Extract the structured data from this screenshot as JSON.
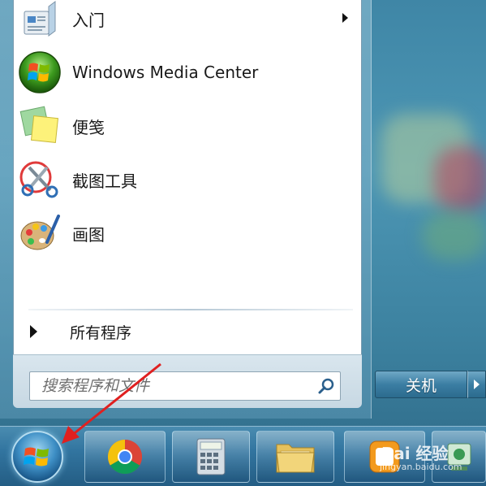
{
  "start_menu": {
    "items": [
      {
        "label": "入门",
        "icon": "getting-started-icon",
        "has_submenu": true
      },
      {
        "label": "Windows Media Center",
        "icon": "windows-media-center-icon",
        "has_submenu": false
      },
      {
        "label": "便笺",
        "icon": "sticky-notes-icon",
        "has_submenu": false
      },
      {
        "label": "截图工具",
        "icon": "snipping-tool-icon",
        "has_submenu": false
      },
      {
        "label": "画图",
        "icon": "paint-icon",
        "has_submenu": false
      }
    ],
    "all_programs_label": "所有程序",
    "search_placeholder": "搜索程序和文件",
    "shutdown_label": "关机"
  },
  "taskbar": {
    "items": [
      {
        "icon": "windows-start-orb-icon"
      },
      {
        "icon": "chrome-icon"
      },
      {
        "icon": "calculator-icon"
      },
      {
        "icon": "file-explorer-icon"
      },
      {
        "icon": "baidu-app-icon"
      },
      {
        "icon": "network-app-icon"
      }
    ],
    "watermark_text": "Bai 经验",
    "watermark_url": "jingyan.baidu.com"
  },
  "colors": {
    "accent": "#3275a0",
    "annotation_arrow": "#e02020"
  }
}
